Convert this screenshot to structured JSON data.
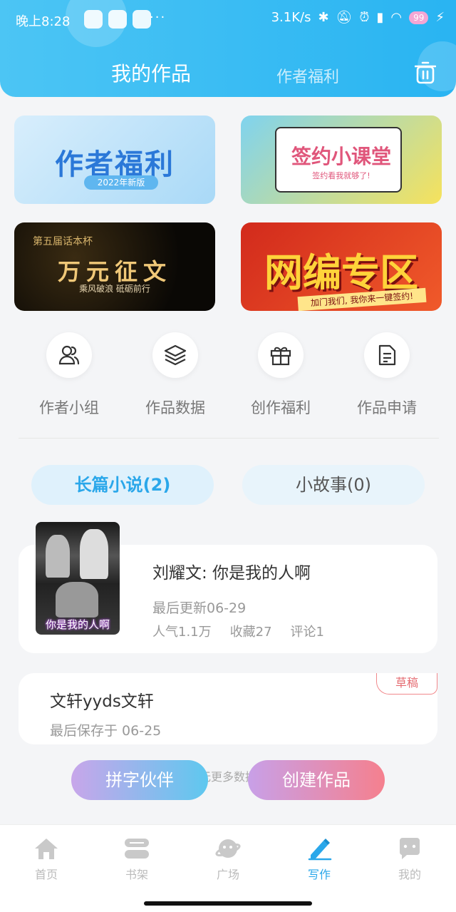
{
  "status_bar": {
    "time": "晚上8:28",
    "dots": "···",
    "net_speed": "3.1K/s",
    "battery": "99"
  },
  "header": {
    "tab_active": "我的作品",
    "tab_inactive": "作者福利",
    "trash_icon": "trash-icon"
  },
  "banners": [
    {
      "title": "作者福利",
      "sub": "2022年新版"
    },
    {
      "title": "签约小课堂",
      "sub": "签约看我就够了!"
    },
    {
      "title": "万元征文",
      "top": "第五届话本杯",
      "sub": "乘风破浪 砥砺前行"
    },
    {
      "title": "网编专区",
      "sub": "加门我们, 我你来一键签约!"
    }
  ],
  "quick_actions": [
    {
      "label": "作者小组",
      "icon": "group-icon"
    },
    {
      "label": "作品数据",
      "icon": "layers-icon"
    },
    {
      "label": "创作福利",
      "icon": "gift-icon"
    },
    {
      "label": "作品申请",
      "icon": "document-icon"
    }
  ],
  "segments": {
    "novel": "长篇小说(2)",
    "story": "小故事(0)"
  },
  "works": [
    {
      "title": "刘耀文: 你是我的人啊",
      "cover_caption": "你是我的人啊",
      "updated": "最后更新06-29",
      "popularity": "人气1.1万",
      "favorites": "收藏27",
      "comments": "评论1"
    }
  ],
  "draft": {
    "title": "文轩yyds文轩",
    "saved": "最后保存于 06-25",
    "badge": "草稿"
  },
  "no_more": "无更多数据",
  "fab": {
    "partner": "拼字伙伴",
    "create": "创建作品"
  },
  "tabbar": [
    {
      "label": "首页",
      "icon": "home-icon"
    },
    {
      "label": "书架",
      "icon": "bookshelf-icon"
    },
    {
      "label": "广场",
      "icon": "planet-icon"
    },
    {
      "label": "写作",
      "icon": "pen-icon"
    },
    {
      "label": "我的",
      "icon": "chat-icon"
    }
  ],
  "colors": {
    "accent": "#2aa7ea",
    "header": "#3bbcf3",
    "draft_badge": "#e56c72"
  }
}
